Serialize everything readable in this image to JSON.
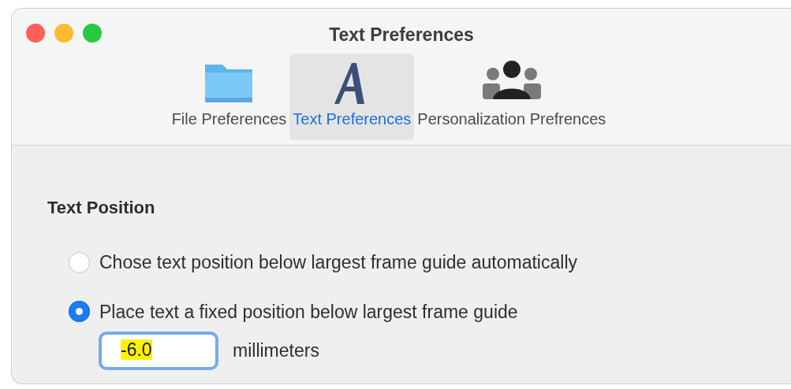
{
  "window": {
    "title": "Text Preferences"
  },
  "tabs": [
    {
      "label": "File Preferences",
      "kind": "folder",
      "selected": false
    },
    {
      "label": "Text Preferences",
      "kind": "font",
      "selected": true
    },
    {
      "label": "Personalization Prefrences",
      "kind": "people",
      "selected": false
    }
  ],
  "section": {
    "title": "Text Position"
  },
  "options": [
    {
      "label": "Chose text position below largest frame guide automatically",
      "selected": false
    },
    {
      "label": "Place text a fixed position below largest frame guide",
      "selected": true
    }
  ],
  "offset": {
    "value": "-6.0",
    "highlighted": true,
    "unit": "millimeters"
  }
}
